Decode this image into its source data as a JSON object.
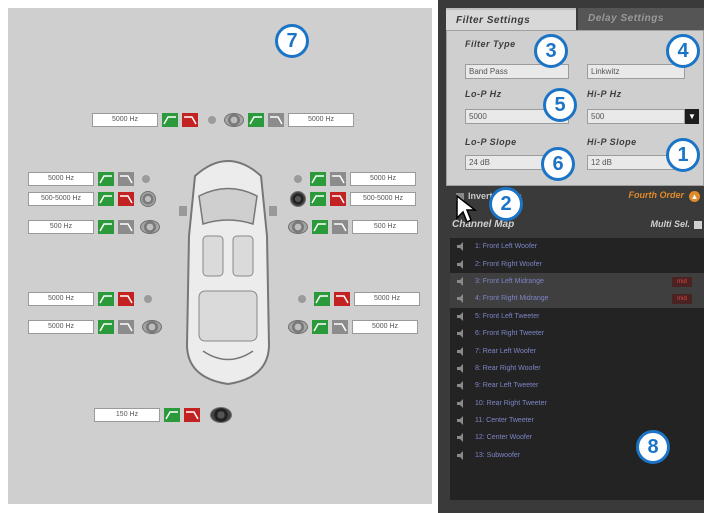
{
  "tabs": {
    "filter_settings": "Filter Settings",
    "delay_settings": "Delay Settings"
  },
  "filter": {
    "filter_type_label": "Filter Type",
    "filter_type_value": "Band Pass",
    "filter_type2_value": "Linkwitz",
    "lop_hz_label": "Lo-P  Hz",
    "lop_hz_value": "5000",
    "hip_hz_label": "Hi-P  Hz",
    "hip_hz_value": "500",
    "lop_slope_label": "Lo-P  Slope",
    "lop_slope_value": "24 dB",
    "hip_slope_label": "Hi-P  Slope",
    "hip_slope_value": "12 dB"
  },
  "phase": {
    "label": "Invert Phase",
    "fourth_order": "Fourth Order"
  },
  "channel_map": {
    "title": "Channel Map",
    "multi_sel": "Multi Sel.",
    "items": [
      {
        "label": "1: Front Left Woofer",
        "tag": ""
      },
      {
        "label": "2: Front Right Woofer",
        "tag": ""
      },
      {
        "label": "3: Front Left Midrange",
        "tag": "mid"
      },
      {
        "label": "4: Front Right Midrange",
        "tag": "mid"
      },
      {
        "label": "5: Front Left Tweeter",
        "tag": ""
      },
      {
        "label": "6: Front Right Tweeter",
        "tag": ""
      },
      {
        "label": "7: Rear Left Woofer",
        "tag": ""
      },
      {
        "label": "8: Rear Right Woofer",
        "tag": ""
      },
      {
        "label": "9: Rear Left Tweeter",
        "tag": ""
      },
      {
        "label": "10: Rear Right Tweeter",
        "tag": ""
      },
      {
        "label": "11: Center Tweeter",
        "tag": ""
      },
      {
        "label": "12: Center Woofer",
        "tag": ""
      },
      {
        "label": "13: Subwoofer",
        "tag": ""
      }
    ]
  },
  "car": {
    "center_left_hz": "5000 Hz",
    "center_right_hz": "5000 Hz",
    "front_left_tw_hz": "5000 Hz",
    "front_left_mid_hz": "500-5000 Hz",
    "front_left_woof_hz": "500 Hz",
    "front_right_tw_hz": "5000 Hz",
    "front_right_mid_hz": "500-5000 Hz",
    "front_right_woof_hz": "500 Hz",
    "rear_left_tw_hz": "5000 Hz",
    "rear_left_woof_hz": "5000 Hz",
    "rear_right_tw_hz": "5000 Hz",
    "rear_right_woof_hz": "5000 Hz",
    "sub_hz": "150 Hz"
  },
  "callouts": {
    "c1": "1",
    "c2": "2",
    "c3": "3",
    "c4": "4",
    "c5": "5",
    "c6": "6",
    "c7": "7",
    "c8": "8"
  },
  "colors": {
    "callout_blue": "#1b74c6",
    "filter_green": "#2a9a3b",
    "filter_red": "#c32222",
    "accent_orange": "#e08a2a",
    "channel_text": "#7d85c6"
  }
}
